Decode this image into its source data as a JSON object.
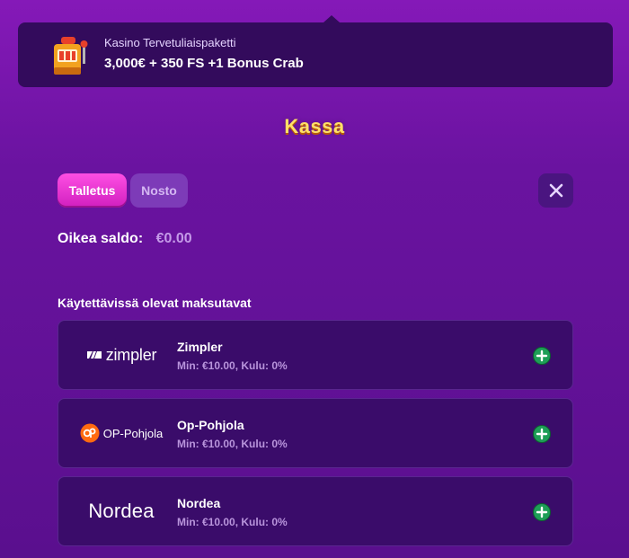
{
  "promo": {
    "subtitle": "Kasino Tervetuliaispaketti",
    "title": "3,000€ + 350 FS +1 Bonus Crab",
    "icon": "slot-machine-icon"
  },
  "page": {
    "title": "Kassa"
  },
  "tabs": [
    {
      "label": "Talletus",
      "active": true
    },
    {
      "label": "Nosto",
      "active": false
    }
  ],
  "balance": {
    "label": "Oikea saldo:",
    "value": "€0.00"
  },
  "methods_section": {
    "heading": "Käytettävissä olevat maksutavat"
  },
  "methods": [
    {
      "name": "Zimpler",
      "meta": "Min: €10.00, Kulu: 0%",
      "logo_text": "zimpler"
    },
    {
      "name": "Op-Pohjola",
      "meta": "Min: €10.00, Kulu: 0%",
      "logo_text": "OP-Pohjola"
    },
    {
      "name": "Nordea",
      "meta": "Min: €10.00, Kulu: 0%",
      "logo_text": "Nordea"
    }
  ],
  "colors": {
    "accent_pink": "#e52ad0",
    "title_yellow": "#ffe066",
    "add_green": "#1e9e57",
    "op_orange": "#ff6a10"
  }
}
